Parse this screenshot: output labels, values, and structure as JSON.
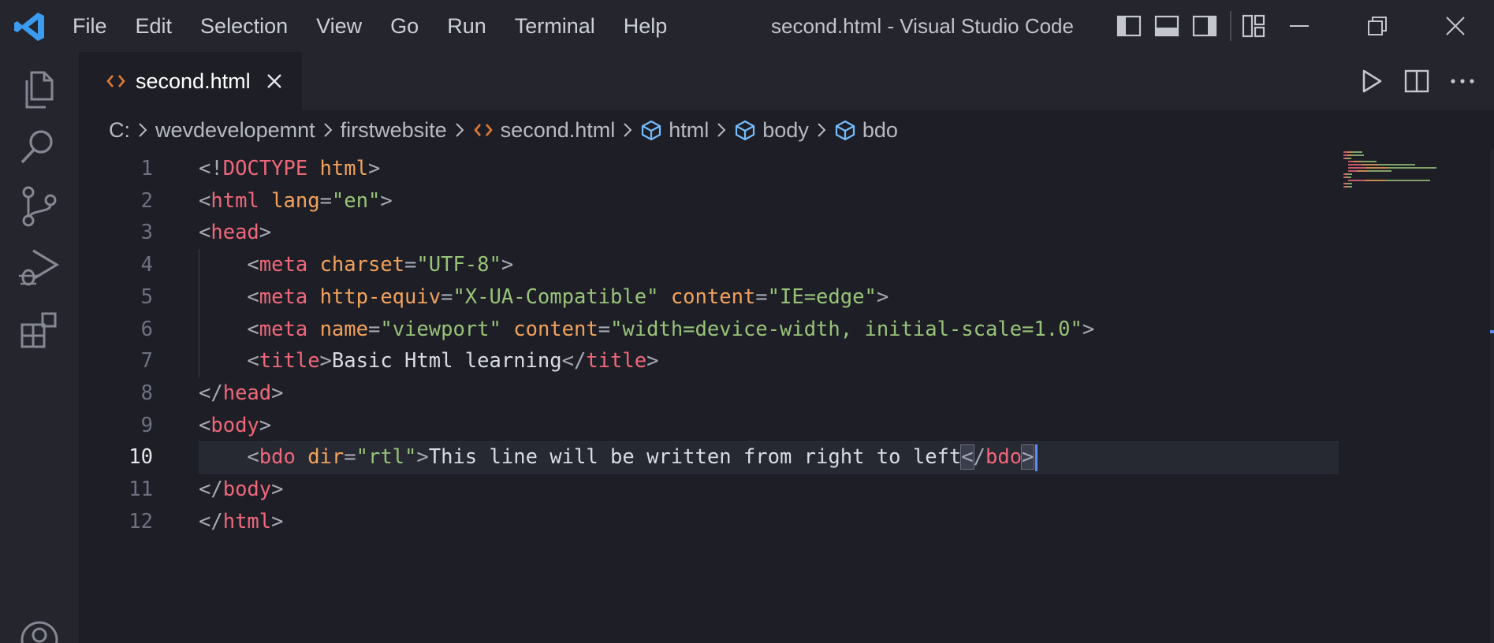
{
  "titlebar": {
    "menu": [
      "File",
      "Edit",
      "Selection",
      "View",
      "Go",
      "Run",
      "Terminal",
      "Help"
    ],
    "title": "second.html - Visual Studio Code"
  },
  "tab": {
    "label": "second.html"
  },
  "breadcrumb": [
    "C:",
    "wevdevelopemnt",
    "firstwebsite",
    "second.html",
    "html",
    "body",
    "bdo"
  ],
  "editor": {
    "active_line": 10,
    "lines": [
      {
        "num": "1",
        "text": "<!DOCTYPE html>"
      },
      {
        "num": "2",
        "text": "<html lang=\"en\">"
      },
      {
        "num": "3",
        "text": "<head>"
      },
      {
        "num": "4",
        "text": "    <meta charset=\"UTF-8\">"
      },
      {
        "num": "5",
        "text": "    <meta http-equiv=\"X-UA-Compatible\" content=\"IE=edge\">"
      },
      {
        "num": "6",
        "text": "    <meta name=\"viewport\" content=\"width=device-width, initial-scale=1.0\">"
      },
      {
        "num": "7",
        "text": "    <title>Basic Html learning</title>"
      },
      {
        "num": "8",
        "text": "</head>"
      },
      {
        "num": "9",
        "text": "<body>"
      },
      {
        "num": "10",
        "text": "    <bdo dir=\"rtl\">This line will be written from right to left</bdo>"
      },
      {
        "num": "11",
        "text": "</body>"
      },
      {
        "num": "12",
        "text": "</html>"
      }
    ]
  },
  "colors": {
    "background": "#1e1f26",
    "tag": "#f0677a",
    "attribute": "#f3a25c",
    "string": "#98c379",
    "cursor": "#5f8df7",
    "html_icon": "#e37933",
    "symbol_icon": "#75beff"
  },
  "icons": {
    "activity_bar": [
      "explorer-icon",
      "search-icon",
      "source-control-icon",
      "run-debug-icon",
      "extensions-icon",
      "account-icon"
    ]
  }
}
